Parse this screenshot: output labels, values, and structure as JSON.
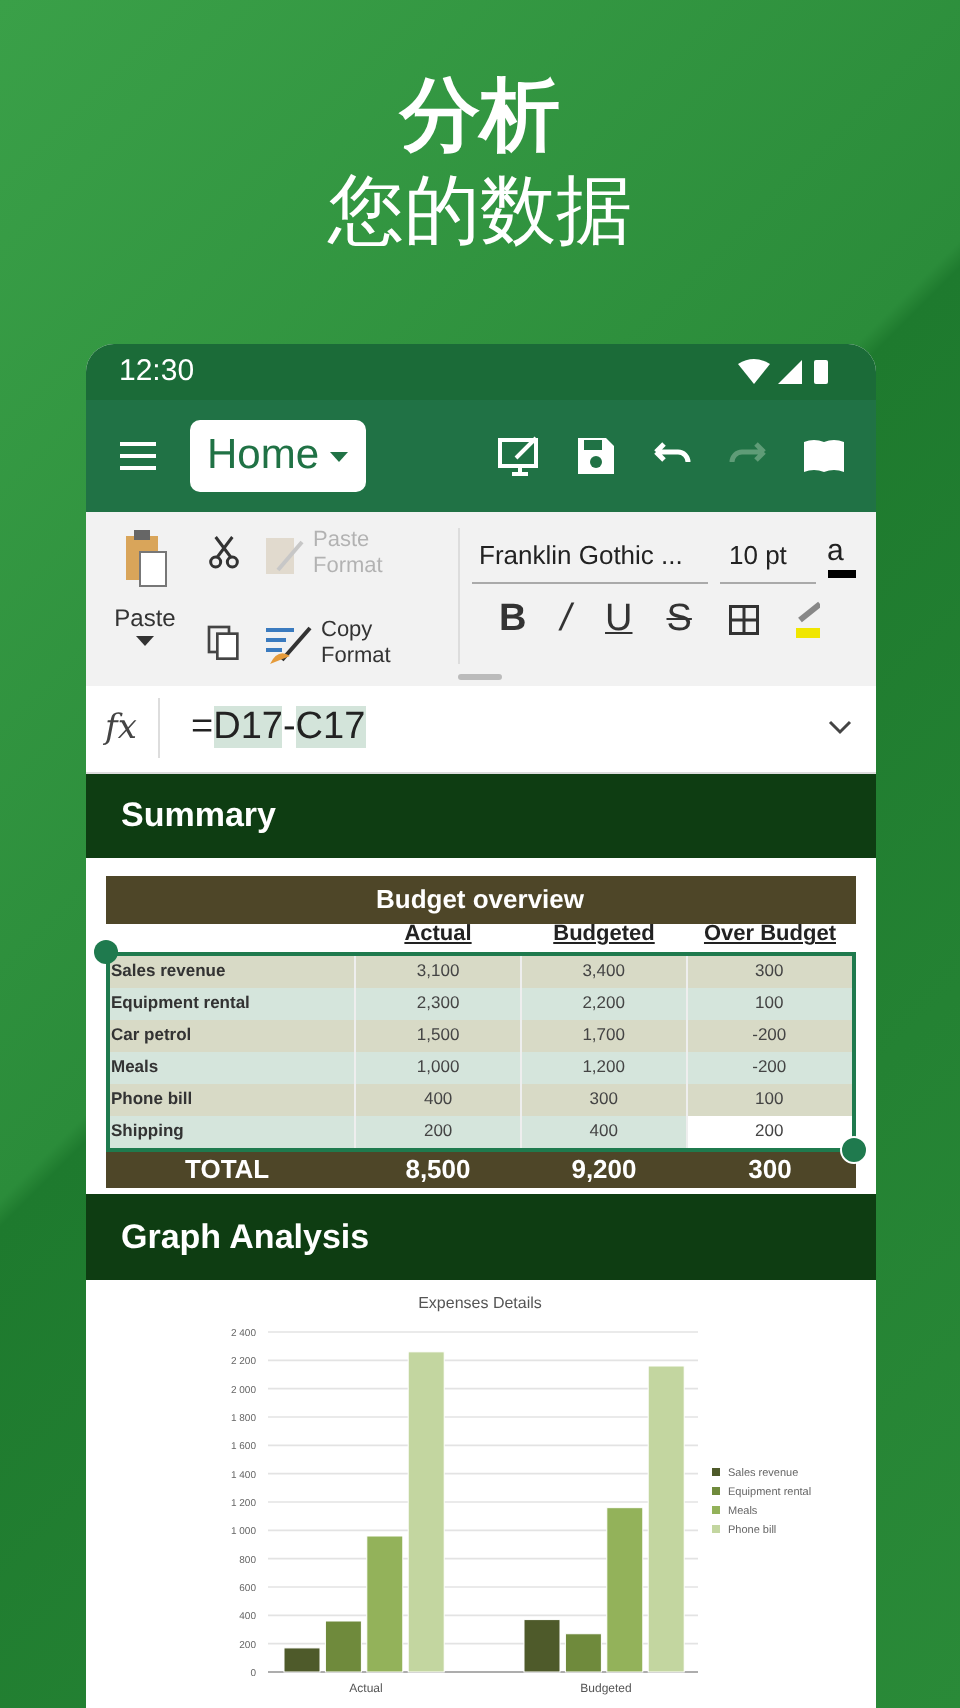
{
  "promo": {
    "title": "分析",
    "subtitle": "您的数据"
  },
  "status_bar": {
    "time": "12:30"
  },
  "toolbar": {
    "view_menu": "Home",
    "redo_disabled": true
  },
  "ribbon": {
    "paste": "Paste",
    "paste_format": {
      "label": "Paste Format",
      "disabled": true
    },
    "copy_format": {
      "label": "Copy Format",
      "disabled": false
    },
    "font": "Franklin Gothic ...",
    "size": "10 pt",
    "styles": [
      {
        "kind": "bold",
        "label": "B"
      },
      {
        "kind": "italic",
        "label": "/"
      },
      {
        "kind": "underline",
        "label": "U"
      },
      {
        "kind": "strike",
        "label": "S"
      },
      {
        "kind": "borders"
      }
    ],
    "font_color_letter": "a"
  },
  "formula_bar": {
    "label": "fx",
    "parts": [
      {
        "text": "=",
        "ref": false
      },
      {
        "text": "D17",
        "ref": true
      },
      {
        "text": "-",
        "ref": false
      },
      {
        "text": "C17",
        "ref": true
      }
    ]
  },
  "summary": {
    "title": "Summary",
    "table": {
      "title": "Budget overview",
      "columns": [
        "Actual",
        "Budgeted",
        "Over Budget"
      ],
      "rows": [
        {
          "label": "Sales revenue",
          "cells": [
            "3,100",
            "3,400",
            "300"
          ],
          "active": false
        },
        {
          "label": "Equipment rental",
          "cells": [
            "2,300",
            "2,200",
            "100"
          ],
          "active": false
        },
        {
          "label": "Car petrol",
          "cells": [
            "1,500",
            "1,700",
            "-200"
          ],
          "active": false
        },
        {
          "label": "Meals",
          "cells": [
            "1,000",
            "1,200",
            "-200"
          ],
          "active": false
        },
        {
          "label": "Phone bill",
          "cells": [
            "400",
            "300",
            "100"
          ],
          "active": false
        },
        {
          "label": "Shipping",
          "cells": [
            "200",
            "400",
            "200"
          ],
          "active": true
        }
      ],
      "total": {
        "label": "TOTAL",
        "cells": [
          "8,500",
          "9,200",
          "300"
        ]
      }
    }
  },
  "graph": {
    "title": "Graph Analysis",
    "chart_data": {
      "type": "bar",
      "title": "Expenses Details",
      "grid": true,
      "legend": "right",
      "categories": [
        "Actual",
        "Budgeted"
      ],
      "ylim": [
        0,
        2400
      ],
      "yticks": [
        {
          "value": 0,
          "label": "0"
        },
        {
          "value": 200,
          "label": "200"
        },
        {
          "value": 400,
          "label": "400"
        },
        {
          "value": 600,
          "label": "600"
        },
        {
          "value": 800,
          "label": "800"
        },
        {
          "value": 1000,
          "label": "1 000"
        },
        {
          "value": 1200,
          "label": "1 200"
        },
        {
          "value": 1400,
          "label": "1 400"
        },
        {
          "value": 1600,
          "label": "1 600"
        },
        {
          "value": 1800,
          "label": "1 800"
        },
        {
          "value": 2000,
          "label": "2 000"
        },
        {
          "value": 2200,
          "label": "2 200"
        },
        {
          "value": 2400,
          "label": "2 400"
        }
      ],
      "series": [
        {
          "name": "Sales revenue",
          "color": "#4e5a2a",
          "values": [
            170,
            370
          ]
        },
        {
          "name": "Equipment rental",
          "color": "#6f8a3c",
          "values": [
            360,
            270
          ]
        },
        {
          "name": "Meals",
          "color": "#93b25a",
          "values": [
            960,
            1160
          ]
        },
        {
          "name": "Phone bill",
          "color": "#c3d6a0",
          "values": [
            2260,
            2160
          ]
        }
      ]
    }
  }
}
